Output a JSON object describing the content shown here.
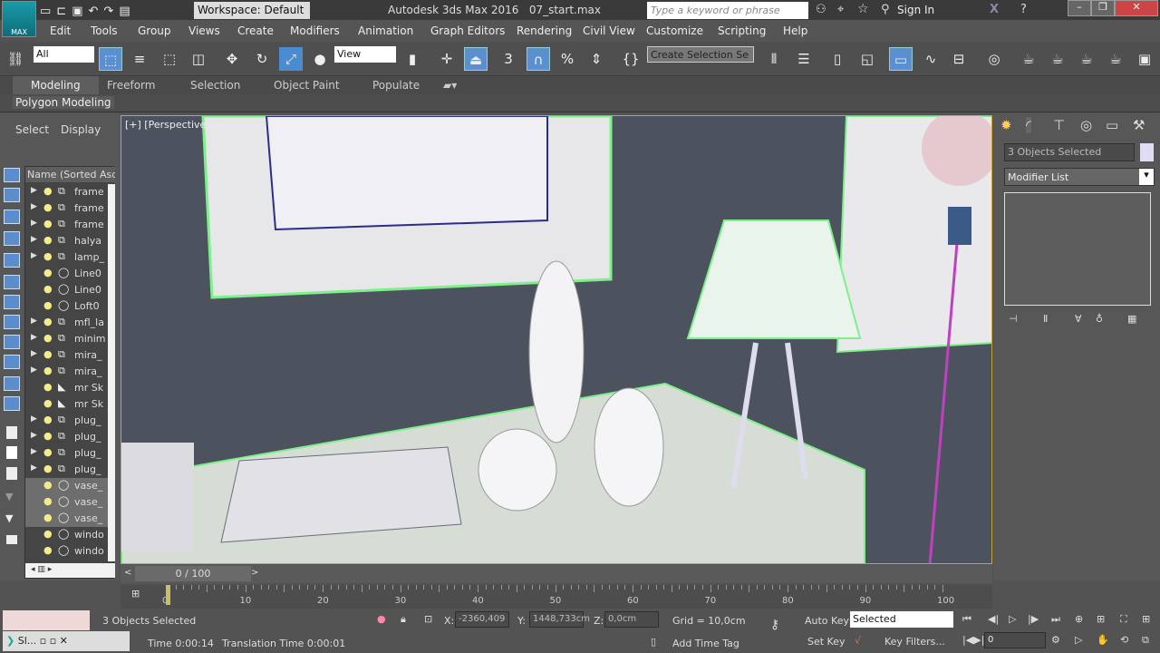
{
  "titlebar": {
    "logo": "MAX",
    "workspace": "Workspace: Default",
    "app_title": "Autodesk 3ds Max 2016",
    "file": "07_start.max",
    "search_placeholder": "Type a keyword or phrase",
    "sign_in": "Sign In"
  },
  "menu": [
    "Edit",
    "Tools",
    "Group",
    "Views",
    "Create",
    "Modifiers",
    "Animation",
    "Graph Editors",
    "Rendering",
    "Civil View",
    "Customize",
    "Scripting",
    "Help"
  ],
  "toolbar": {
    "filter": "All",
    "ref_coord": "View",
    "selection_set": "Create Selection Se",
    "snap_label": "3"
  },
  "ribbon": {
    "tabs": [
      "Modeling",
      "Freeform",
      "Selection",
      "Object Paint",
      "Populate"
    ],
    "active": "Modeling",
    "panel": "Polygon Modeling"
  },
  "explorer": {
    "tabs": [
      "Select",
      "Display"
    ],
    "column": "Name (Sorted Ascer",
    "items": [
      {
        "name": "frame",
        "expand": true,
        "type": "group"
      },
      {
        "name": "frame",
        "expand": true,
        "type": "group"
      },
      {
        "name": "frame",
        "expand": true,
        "type": "group"
      },
      {
        "name": "halya",
        "expand": true,
        "type": "group"
      },
      {
        "name": "lamp_",
        "expand": true,
        "type": "group"
      },
      {
        "name": "Line0",
        "expand": false,
        "type": "shape"
      },
      {
        "name": "Line0",
        "expand": false,
        "type": "shape"
      },
      {
        "name": "Loft0",
        "expand": false,
        "type": "geo"
      },
      {
        "name": "mfl_la",
        "expand": true,
        "type": "group"
      },
      {
        "name": "minim",
        "expand": true,
        "type": "group"
      },
      {
        "name": "mira_",
        "expand": true,
        "type": "group"
      },
      {
        "name": "mira_",
        "expand": true,
        "type": "group"
      },
      {
        "name": "mr Sk",
        "expand": false,
        "type": "light"
      },
      {
        "name": "mr Sk",
        "expand": false,
        "type": "light"
      },
      {
        "name": "plug_",
        "expand": true,
        "type": "group"
      },
      {
        "name": "plug_",
        "expand": true,
        "type": "group"
      },
      {
        "name": "plug_",
        "expand": true,
        "type": "group"
      },
      {
        "name": "plug_",
        "expand": true,
        "type": "group"
      },
      {
        "name": "vase_",
        "expand": false,
        "type": "shape",
        "selected": true
      },
      {
        "name": "vase_",
        "expand": false,
        "type": "shape",
        "selected": true
      },
      {
        "name": "vase_",
        "expand": false,
        "type": "shape",
        "selected": true
      },
      {
        "name": "windo",
        "expand": false,
        "type": "geo"
      },
      {
        "name": "windo",
        "expand": false,
        "type": "geo"
      }
    ]
  },
  "viewport": {
    "label": "[+] [Perspective"
  },
  "command_panel": {
    "selection": "3 Objects Selected",
    "modifier_list": "Modifier List",
    "color": "#e0dcf4"
  },
  "timeline": {
    "frame": "0 / 100",
    "ticks": [
      "0",
      "10",
      "20",
      "30",
      "40",
      "50",
      "60",
      "70",
      "80",
      "90",
      "100"
    ]
  },
  "status": {
    "selected": "3 Objects Selected",
    "x_label": "X:",
    "x": "-2360,409",
    "y_label": "Y:",
    "y": "1448,733cm",
    "z_label": "Z:",
    "z": "0,0cm",
    "grid": "Grid = 10,0cm",
    "time": "Time 0:00:14",
    "translation_time": "Translation Time 0:00:01",
    "add_time_tag": "Add Time Tag",
    "auto_key": "Auto Key",
    "set_key": "Set Key",
    "key_mode": "Selected",
    "key_filters": "Key Filters...",
    "current_frame": "0",
    "maxscript": "Sl..."
  },
  "colors": {
    "selection_green": "#7ef08a",
    "active_blue": "#5a8fd0",
    "viewport_bg": "#4c535f"
  }
}
